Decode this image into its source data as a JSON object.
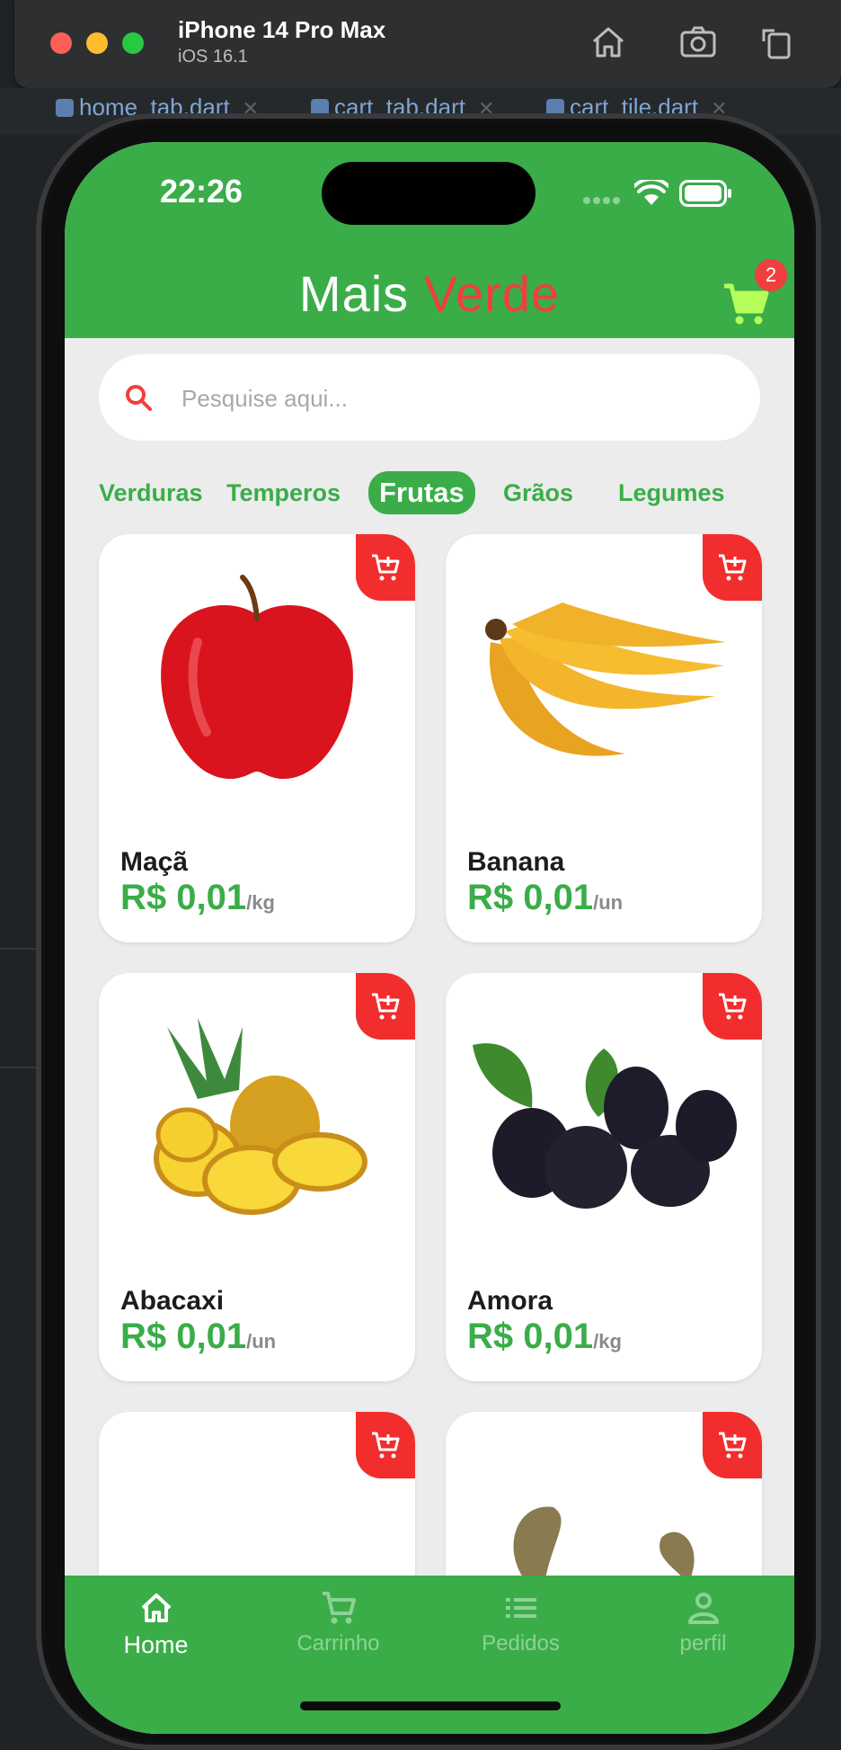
{
  "simulator": {
    "device": "iPhone 14 Pro Max",
    "os": "iOS 16.1"
  },
  "ide": {
    "tabs": [
      "home_tab.dart",
      "cart_tab.dart",
      "cart_tile.dart"
    ]
  },
  "status_bar": {
    "time": "22:26"
  },
  "app": {
    "title_part1": "Mais ",
    "title_part2": "Verde",
    "cart_count": "2",
    "colors": {
      "primary": "#3aad48",
      "accent": "#f13e3e"
    }
  },
  "search": {
    "placeholder": "Pesquise aqui..."
  },
  "categories": [
    "Verduras",
    "Temperos",
    "Frutas",
    "Grãos",
    "Legumes"
  ],
  "selected_category": "Frutas",
  "products": [
    {
      "name": "Maçã",
      "price": "R$ 0,01",
      "unit": "/kg"
    },
    {
      "name": "Banana",
      "price": "R$ 0,01",
      "unit": "/un"
    },
    {
      "name": "Abacaxi",
      "price": "R$ 0,01",
      "unit": "/un"
    },
    {
      "name": "Amora",
      "price": "R$ 0,01",
      "unit": "/kg"
    }
  ],
  "bottom_nav": [
    {
      "label": "Home",
      "icon": "home-icon"
    },
    {
      "label": "Carrinho",
      "icon": "cart-icon"
    },
    {
      "label": "Pedidos",
      "icon": "list-icon"
    },
    {
      "label": "perfil",
      "icon": "person-icon"
    }
  ]
}
